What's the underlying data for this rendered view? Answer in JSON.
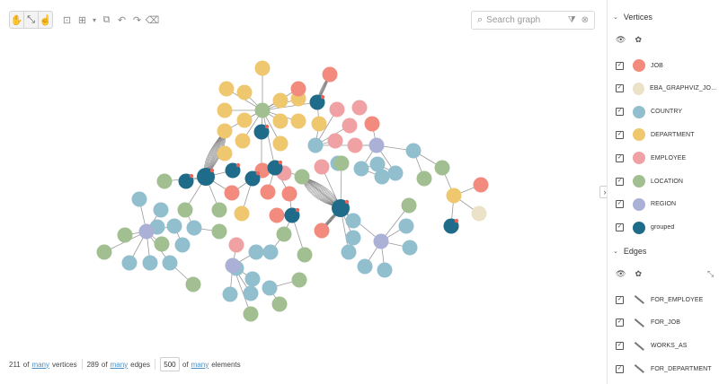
{
  "toolbar": {
    "tools": [
      {
        "name": "pan-tool-icon",
        "glyph": "✋"
      },
      {
        "name": "zoom-tool-icon",
        "glyph": "⤡"
      },
      {
        "name": "select-tool-icon",
        "glyph": "☝"
      }
    ],
    "actions": [
      {
        "name": "fit-view-icon",
        "glyph": "⊡"
      },
      {
        "name": "layout-icon",
        "glyph": "⊞"
      },
      {
        "name": "layout-dropdown-icon",
        "glyph": "▾"
      },
      {
        "name": "group-icon",
        "glyph": "⧉"
      },
      {
        "name": "undo-icon",
        "glyph": "↶"
      },
      {
        "name": "redo-icon",
        "glyph": "↷"
      },
      {
        "name": "eraser-icon",
        "glyph": "⌫"
      }
    ]
  },
  "search": {
    "placeholder": "Search graph"
  },
  "footer": {
    "vertices_count": "211",
    "of_text": "of",
    "many_text": "many",
    "vertices_text": "vertices",
    "edges_count": "289",
    "edges_text": "edges",
    "limit_value": "500",
    "elements_text": "elements"
  },
  "panel": {
    "vertices_title": "Vertices",
    "edges_title": "Edges",
    "vertices": [
      {
        "label": "JOB",
        "color": "#f28b7d"
      },
      {
        "label": "EBA_GRAPHVIZ_JOB_...",
        "color": "#ebe2c8"
      },
      {
        "label": "COUNTRY",
        "color": "#92bfce"
      },
      {
        "label": "DEPARTMENT",
        "color": "#efc76e"
      },
      {
        "label": "EMPLOYEE",
        "color": "#f0a1a3"
      },
      {
        "label": "LOCATION",
        "color": "#a1bf90"
      },
      {
        "label": "REGION",
        "color": "#aab0d6"
      },
      {
        "label": "grouped",
        "color": "#1e6b8a"
      }
    ],
    "edges": [
      {
        "label": "FOR_EMPLOYEE"
      },
      {
        "label": "FOR_JOB"
      },
      {
        "label": "WORKS_AS"
      },
      {
        "label": "FOR_DEPARTMENT"
      }
    ]
  },
  "colors": {
    "job": "#f28b7d",
    "country": "#92bfce",
    "department": "#efc76e",
    "employee": "#f0a1a3",
    "location": "#a1bf90",
    "region": "#aab0d6",
    "grouped": "#1e6b8a",
    "eba": "#ebe2c8",
    "edge": "#8c8c8c",
    "badge": "#e8645a"
  }
}
